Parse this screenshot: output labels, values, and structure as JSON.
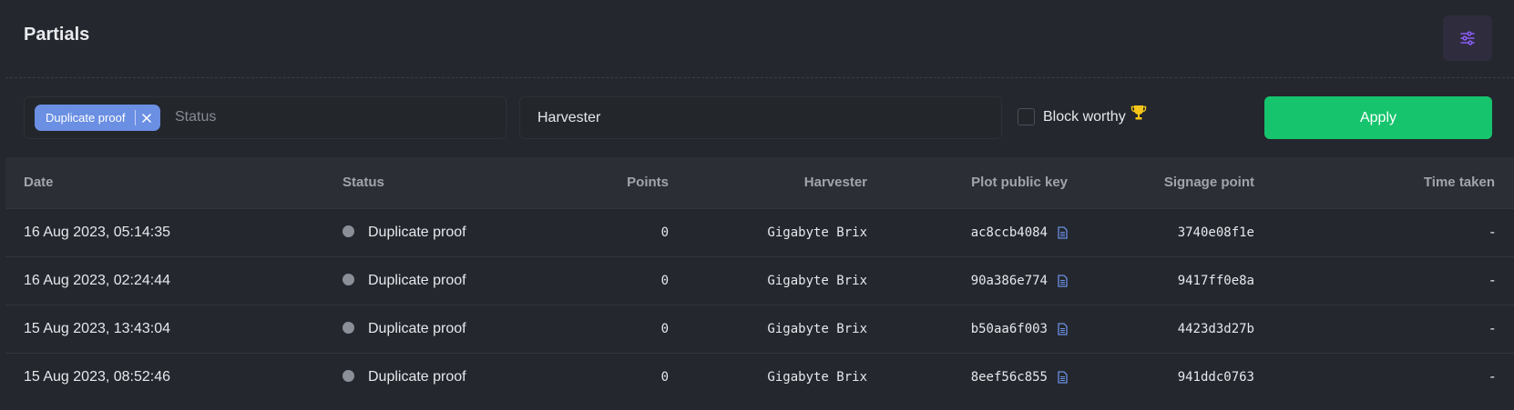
{
  "header": {
    "title": "Partials",
    "filter_icon": "sliders-icon",
    "accent": "#8b5cf6"
  },
  "filters": {
    "status_chip": "Duplicate proof",
    "status_placeholder": "Status",
    "harvester_value": "Harvester",
    "block_worthy_label": "Block worthy",
    "block_worthy_checked": false,
    "apply_label": "Apply",
    "apply_color": "#16c46d",
    "trophy_color": "#f5c518"
  },
  "table": {
    "headers": {
      "date": "Date",
      "status": "Status",
      "points": "Points",
      "harvester": "Harvester",
      "plot": "Plot public key",
      "signage": "Signage point",
      "time": "Time taken"
    },
    "rows": [
      {
        "date": "16 Aug 2023, 05:14:35",
        "status": "Duplicate proof",
        "points": "0",
        "harvester": "Gigabyte Brix",
        "plot": "ac8ccb4084",
        "signage": "3740e08f1e",
        "time": "-"
      },
      {
        "date": "16 Aug 2023, 02:24:44",
        "status": "Duplicate proof",
        "points": "0",
        "harvester": "Gigabyte Brix",
        "plot": "90a386e774",
        "signage": "9417ff0e8a",
        "time": "-"
      },
      {
        "date": "15 Aug 2023, 13:43:04",
        "status": "Duplicate proof",
        "points": "0",
        "harvester": "Gigabyte Brix",
        "plot": "b50aa6f003",
        "signage": "4423d3d27b",
        "time": "-"
      },
      {
        "date": "15 Aug 2023, 08:52:46",
        "status": "Duplicate proof",
        "points": "0",
        "harvester": "Gigabyte Brix",
        "plot": "8eef56c855",
        "signage": "941ddc0763",
        "time": "-"
      }
    ]
  }
}
